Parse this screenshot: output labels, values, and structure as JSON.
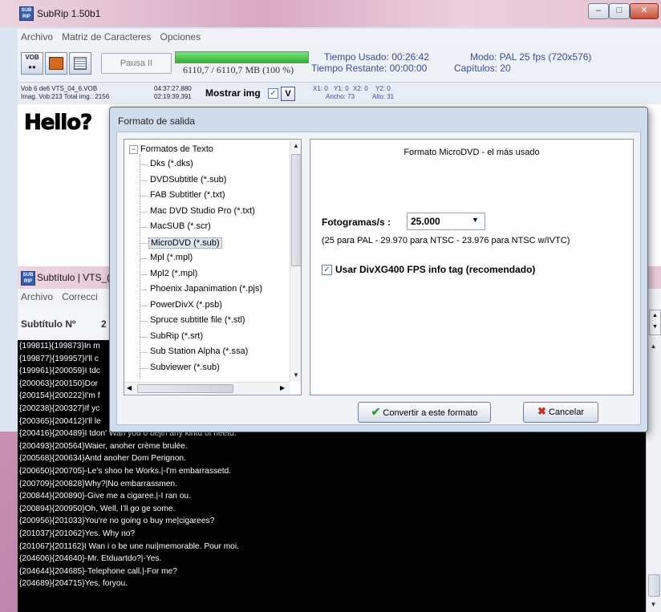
{
  "main_window": {
    "title": "SubRip 1.50b1",
    "menu": [
      "Archivo",
      "Matriz de Caracteres",
      "Opciones"
    ],
    "toolbar": {
      "pause_label": "Pausa II",
      "progress_text": "6110,7 / 6110,7 MB (100 %)",
      "progress_fraction": 1.0,
      "tiempo_usado": "Tiempo Usado: 00:26:42",
      "tiempo_restante": "Tiempo Restante: 00:00:00",
      "modo": "Modo: PAL 25 fps (720x576)",
      "capitulos": "Capítulos: 20"
    },
    "info": {
      "vob_line": "Vob 6   de6   VTS_04_6.VOB",
      "imag_line": "Imag. Vob:213   Total img.: 2156",
      "time1": "04:37:27,880",
      "time2": "02:19:39,391",
      "mostrar_label": "Mostrar img",
      "v_button": "V",
      "x1": "X1: 0",
      "y1": "Y1: 0",
      "x2": "X2: 0",
      "y2": "Y2: 0",
      "ancho": "Ancho: 73",
      "alto": "Alto: 31"
    },
    "preview_text": "Hello?"
  },
  "subtitle_window": {
    "title": "Subtítulo | VTS_(",
    "menu": [
      "Archivo",
      "Correcci"
    ],
    "subtitulo_label": "Subtítulo Nº",
    "subtitulo_num": "2",
    "lines": [
      "{199811}{199873}In m",
      "{199877}{199957}I'll c",
      "{199961}{200059}I tdc",
      "{200063}{200150}Dor",
      "{200154}{200222}I'm f",
      "{200238}{200327}If yc",
      "{200365}{200412}I'll le",
      "{200416}{200489}I tdon' Wan you o bejin any kintd of neetd.",
      "{200493}{200564}Waier, anoher crème brulée.",
      "{200568}{200634}Antd anoher Dom Perignon.",
      "{200650}{200705}-Le's shoo he Works.|-I'm embarrassetd.",
      "{200709}{200828}Why?|No embarrassmen.",
      "{200844}{200890}-Give me a cigaree.|-I ran ou.",
      "{200894}{200950}Oh, Well, I'll go ge some.",
      "{200956}{201033}You're no going o buy me|cigarees?",
      "{201037}{201062}Yes. Why no?",
      "{201067}{201162}I Wan i o be une nui|memorable. Pour moi.",
      "{204606}{204640}-Mr. Etduartdo?|-Yes.",
      "{204644}{204685}-Telephone call.|-For me?",
      "{204689}{204715}Yes, foryou."
    ]
  },
  "dialog": {
    "title": "Formato de salida",
    "tree_root": "Formatos de Texto",
    "formats": [
      "Dks (*.dks)",
      "DVDSubtitle (*.sub)",
      "FAB Subtitler (*.txt)",
      "Mac DVD Studio Pro (*.txt)",
      "MacSUB (*.scr)",
      "MicroDVD (*.sub)",
      "Mpl (*.mpl)",
      "Mpl2 (*.mpl)",
      "Phoenix Japanimation (*.pjs)",
      "PowerDivX (*.psb)",
      "Spruce subtitle file (*.stl)",
      "SubRip (*.srt)",
      "Sub Station Alpha (*.ssa)",
      "Subviewer (*.sub)"
    ],
    "selected_format": "MicroDVD (*.sub)",
    "format_heading": "Formato MicroDVD - el más usado",
    "fps_label": "Fotogramas/s :",
    "fps_value": "25.000",
    "fps_note": "(25 para PAL - 29.970 para NTSC - 23.976 para NTSC w/IVTC)",
    "divx_label": "Usar DivXG400 FPS info tag (recomendado)",
    "divx_checked": true,
    "convert_button": "Convertir a este formato",
    "cancel_button": "Cancelar"
  },
  "colors": {
    "subtitle_list_bg": "#000000",
    "progress_fill": "#2fb42f",
    "info_text": "#3a4aa0"
  }
}
